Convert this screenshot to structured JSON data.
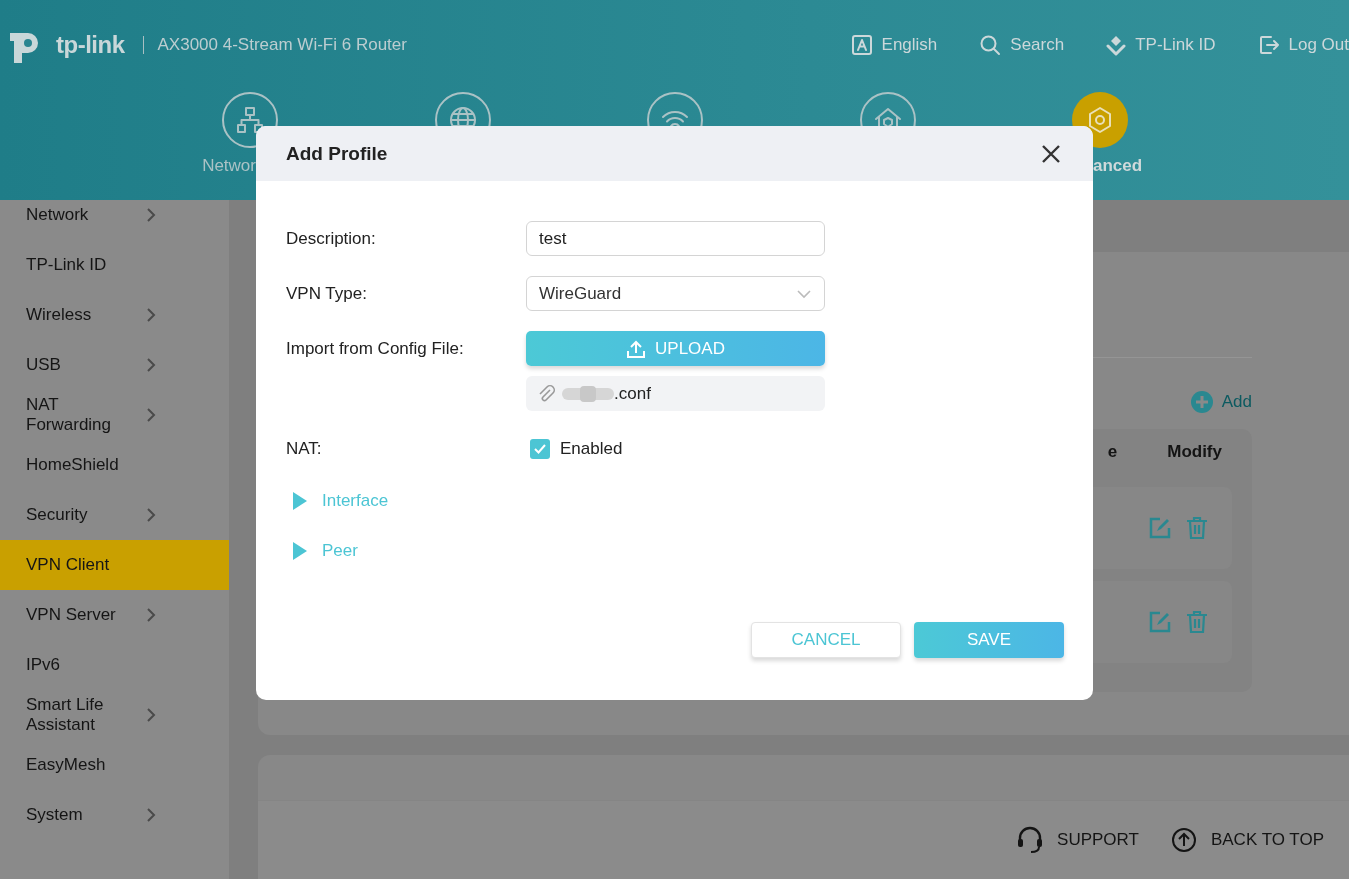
{
  "header": {
    "logo": "tp-link",
    "model": "AX3000 4-Stream Wi-Fi 6 Router",
    "actions": [
      {
        "kind": "language",
        "label": "English"
      },
      {
        "kind": "search",
        "label": "Search"
      },
      {
        "kind": "account",
        "label": "TP-Link ID"
      },
      {
        "kind": "logout",
        "label": "Log Out"
      }
    ],
    "nav": [
      {
        "kind": "network",
        "label": "Networ",
        "selected": false
      },
      {
        "kind": "internet",
        "selected": false
      },
      {
        "kind": "wireless",
        "selected": false
      },
      {
        "kind": "security",
        "selected": false
      },
      {
        "kind": "advanced",
        "label": "anced",
        "selected": true
      }
    ]
  },
  "sidebar": {
    "items": [
      {
        "label": "Network",
        "has_children": true,
        "selected": false
      },
      {
        "label": "TP-Link ID",
        "has_children": false,
        "selected": false
      },
      {
        "label": "Wireless",
        "has_children": true,
        "selected": false
      },
      {
        "label": "USB",
        "has_children": true,
        "selected": false
      },
      {
        "label": "NAT Forwarding",
        "has_children": true,
        "selected": false
      },
      {
        "label": "HomeShield",
        "has_children": false,
        "selected": false
      },
      {
        "label": "Security",
        "has_children": true,
        "selected": false
      },
      {
        "label": "VPN Client",
        "has_children": false,
        "selected": true
      },
      {
        "label": "VPN Server",
        "has_children": true,
        "selected": false
      },
      {
        "label": "IPv6",
        "has_children": false,
        "selected": false
      },
      {
        "label": "Smart Life Assistant",
        "has_children": true,
        "selected": false
      },
      {
        "label": "EasyMesh",
        "has_children": false,
        "selected": false
      },
      {
        "label": "System",
        "has_children": true,
        "selected": false
      }
    ]
  },
  "profile_panel": {
    "add_label": "Add",
    "columns": [
      "e",
      "Modify"
    ],
    "rows": [
      {
        "editable": true,
        "deletable": true
      },
      {
        "editable": true,
        "deletable": true
      }
    ]
  },
  "footer": {
    "support": "SUPPORT",
    "back_to_top": "BACK TO TOP"
  },
  "dialog": {
    "title": "Add Profile",
    "description": {
      "label": "Description:",
      "value": "test"
    },
    "vpn_type": {
      "label": "VPN Type:",
      "value": "WireGuard"
    },
    "import": {
      "label": "Import from Config File:",
      "button": "UPLOAD",
      "file": ".conf"
    },
    "nat": {
      "label": "NAT:",
      "option": "Enabled",
      "checked": true
    },
    "sections": [
      {
        "label": "Interface",
        "expanded": false
      },
      {
        "label": "Peer",
        "expanded": false
      }
    ],
    "buttons": [
      {
        "kind": "secondary",
        "label": "CANCEL"
      },
      {
        "kind": "primary",
        "label": "SAVE"
      }
    ]
  }
}
